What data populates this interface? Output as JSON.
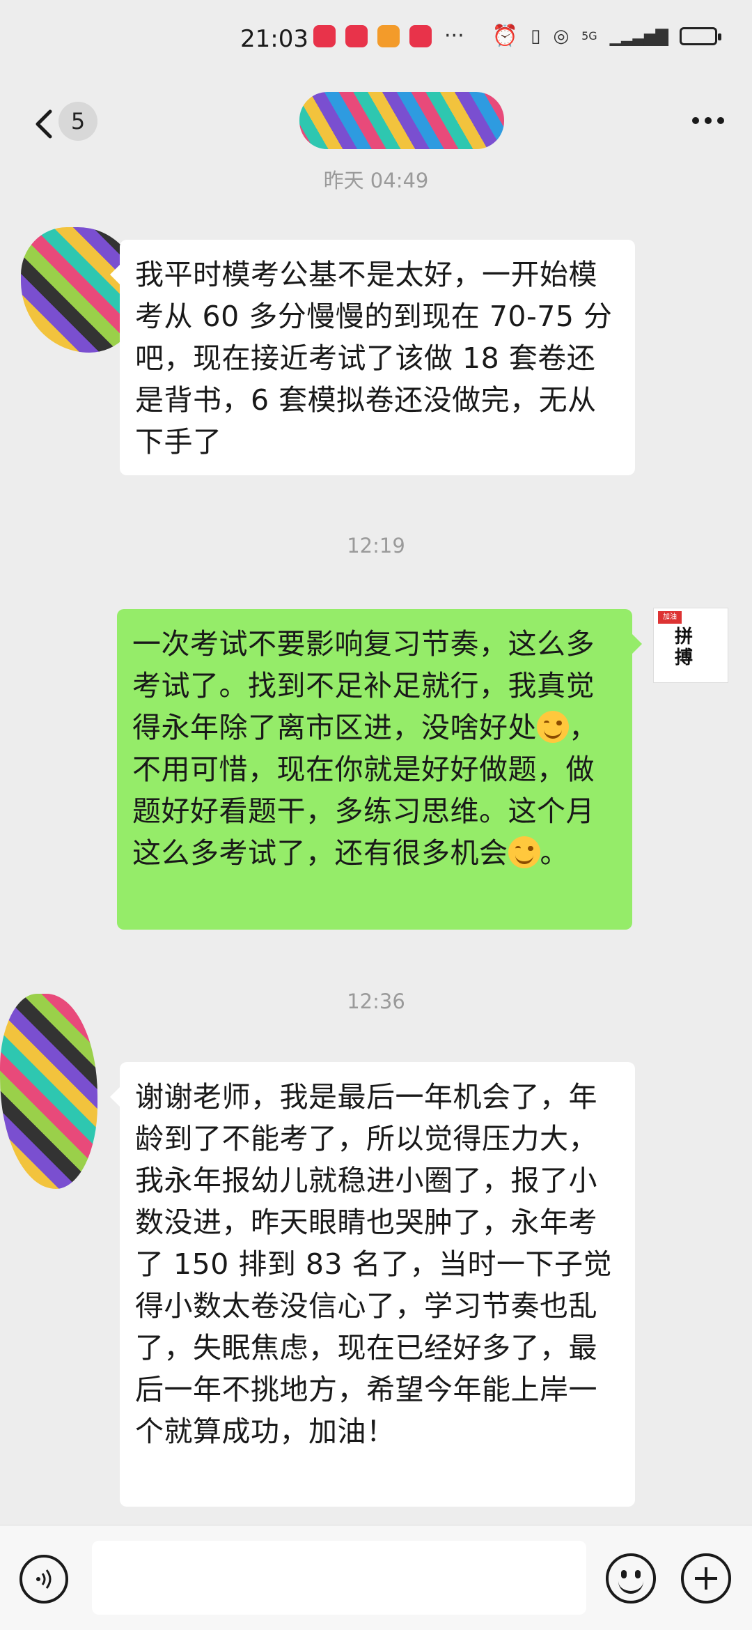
{
  "status_bar": {
    "time": "21:03",
    "apps": [
      {
        "name": "xiaohongshu",
        "color": "#e8334a"
      },
      {
        "name": "book-app",
        "color": "#e8334a"
      },
      {
        "name": "video-app",
        "color": "#f39b2a"
      },
      {
        "name": "huawei-app",
        "color": "#e8334a"
      }
    ],
    "more": "···",
    "network": "5G"
  },
  "nav": {
    "unread_count": "5"
  },
  "messages": [
    {
      "type": "timestamp",
      "text": "昨天 04:49"
    },
    {
      "type": "incoming",
      "text": "我平时模考公基不是太好，一开始模考从 60 多分慢慢的到现在 70-75 分吧，现在接近考试了该做 18 套卷还是背书，6 套模拟卷还没做完，无从下手了"
    },
    {
      "type": "timestamp",
      "text": "12:19"
    },
    {
      "type": "outgoing",
      "text_1": "一次考试不要影响复习节奏，这么多考试了。找到不足补足就行，我真觉得永年除了离市区进，没啥好处",
      "text_2": "，不用可惜，现在你就是好好做题，做题好好看题干，多练习思维。这个月这么多考试了，还有很多机会",
      "text_3": "。"
    },
    {
      "type": "timestamp",
      "text": "12:36"
    },
    {
      "type": "incoming",
      "text": "谢谢老师，我是最后一年机会了，年龄到了不能考了，所以觉得压力大，我永年报幼儿就稳进小圈了，报了小数没进，昨天眼睛也哭肿了，永年考了 150 排到 83 名了，当时一下子觉得小数太卷没信心了，学习节奏也乱了，失眠焦虑，现在已经好多了，最后一年不挑地方，希望今年能上岸一个就算成功，加油！"
    }
  ],
  "my_avatar": {
    "tag": "加油",
    "text": "拼搏"
  },
  "colors": {
    "outgoing_bubble": "#95ec69",
    "incoming_bubble": "#ffffff",
    "background": "#ededed"
  }
}
